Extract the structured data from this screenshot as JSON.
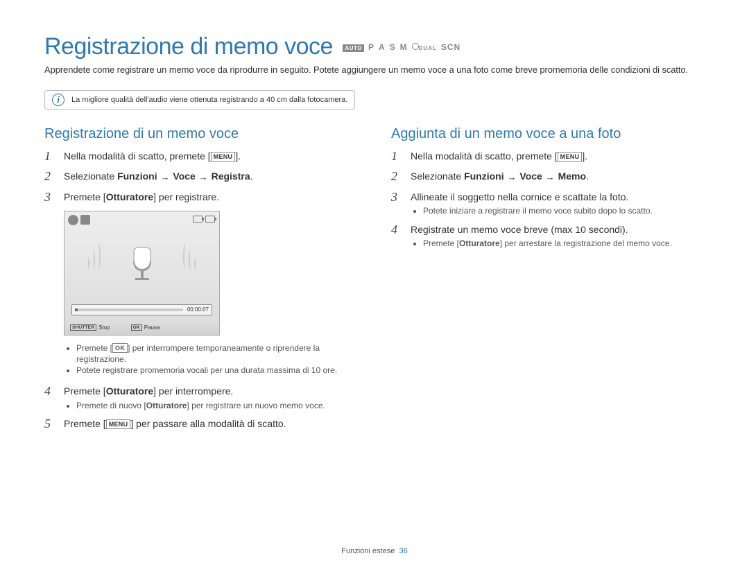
{
  "title": "Registrazione di memo voce",
  "modes": {
    "auto": "AUTO",
    "p": "P",
    "a": "A",
    "s": "S",
    "m": "M",
    "dual": "DUAL",
    "scn": "SCN"
  },
  "intro": "Apprendete come registrare un memo voce da riprodurre in seguito. Potete aggiungere un memo voce a una foto come breve promemoria delle condizioni di scatto.",
  "note": "La migliore qualità dell'audio viene ottenuta registrando a 40 cm dalla fotocamera.",
  "left": {
    "title": "Registrazione di un memo voce",
    "steps": {
      "s1": {
        "pre": "Nella modalità di scatto, premete [",
        "btn": "MENU",
        "post": "]."
      },
      "s2": {
        "pre": "Selezionate ",
        "b1": "Funzioni",
        "arrow1": "→",
        "b2": "Voce",
        "arrow2": "→",
        "b3": "Registra",
        "post": "."
      },
      "s3": {
        "pre": "Premete [",
        "b": "Otturatore",
        "post": "] per registrare."
      },
      "lcd": {
        "time": "00:00:07",
        "shutter_label": "SHUTTER",
        "stop": "Stop",
        "ok_label": "OK",
        "pausa": "Pausa"
      },
      "bul1": {
        "pre": "Premete [",
        "btn": "OK",
        "post": "] per interrompere temporaneamente o riprendere la registrazione."
      },
      "bul2": "Potete registrare promemoria vocali per una durata massima di 10 ore.",
      "s4": {
        "pre": "Premete [",
        "b": "Otturatore",
        "post": "] per interrompere."
      },
      "bul3": {
        "pre": "Premete di nuovo [",
        "b": "Otturatore",
        "post": "] per registrare un nuovo memo voce."
      },
      "s5": {
        "pre": "Premete [",
        "btn": "MENU",
        "post": "] per passare alla modalità di scatto."
      }
    }
  },
  "right": {
    "title": "Aggiunta di un memo voce a una foto",
    "steps": {
      "s1": {
        "pre": "Nella modalità di scatto, premete [",
        "btn": "MENU",
        "post": "]."
      },
      "s2": {
        "pre": "Selezionate ",
        "b1": "Funzioni",
        "arrow1": "→",
        "b2": "Voce",
        "arrow2": "→",
        "b3": "Memo",
        "post": "."
      },
      "s3": "Allineate il soggetto nella cornice e scattate la foto.",
      "bul1": "Potete iniziare a registrare il memo voce subito dopo lo scatto.",
      "s4": "Registrate un memo voce breve (max 10 secondi).",
      "bul2": {
        "pre": "Premete [",
        "b": "Otturatore",
        "post": "] per arrestare la registrazione del memo voce."
      }
    }
  },
  "footer": {
    "section": "Funzioni estese",
    "page": "36"
  }
}
